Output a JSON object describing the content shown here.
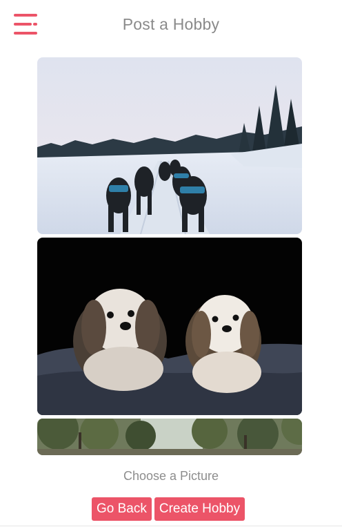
{
  "header": {
    "title": "Post a Hobby",
    "menu_icon": "hamburger-menu-icon"
  },
  "pictures": [
    {
      "subject": "sled dogs running on snowy trail"
    },
    {
      "subject": "two shih tzu dogs on dark rug"
    },
    {
      "subject": "forest trees"
    }
  ],
  "choose_label": "Choose a Picture",
  "actions": {
    "back_label": "Go Back",
    "create_label": "Create Hobby"
  },
  "colors": {
    "accent": "#ec5468",
    "title_text": "#8a8a8a"
  }
}
